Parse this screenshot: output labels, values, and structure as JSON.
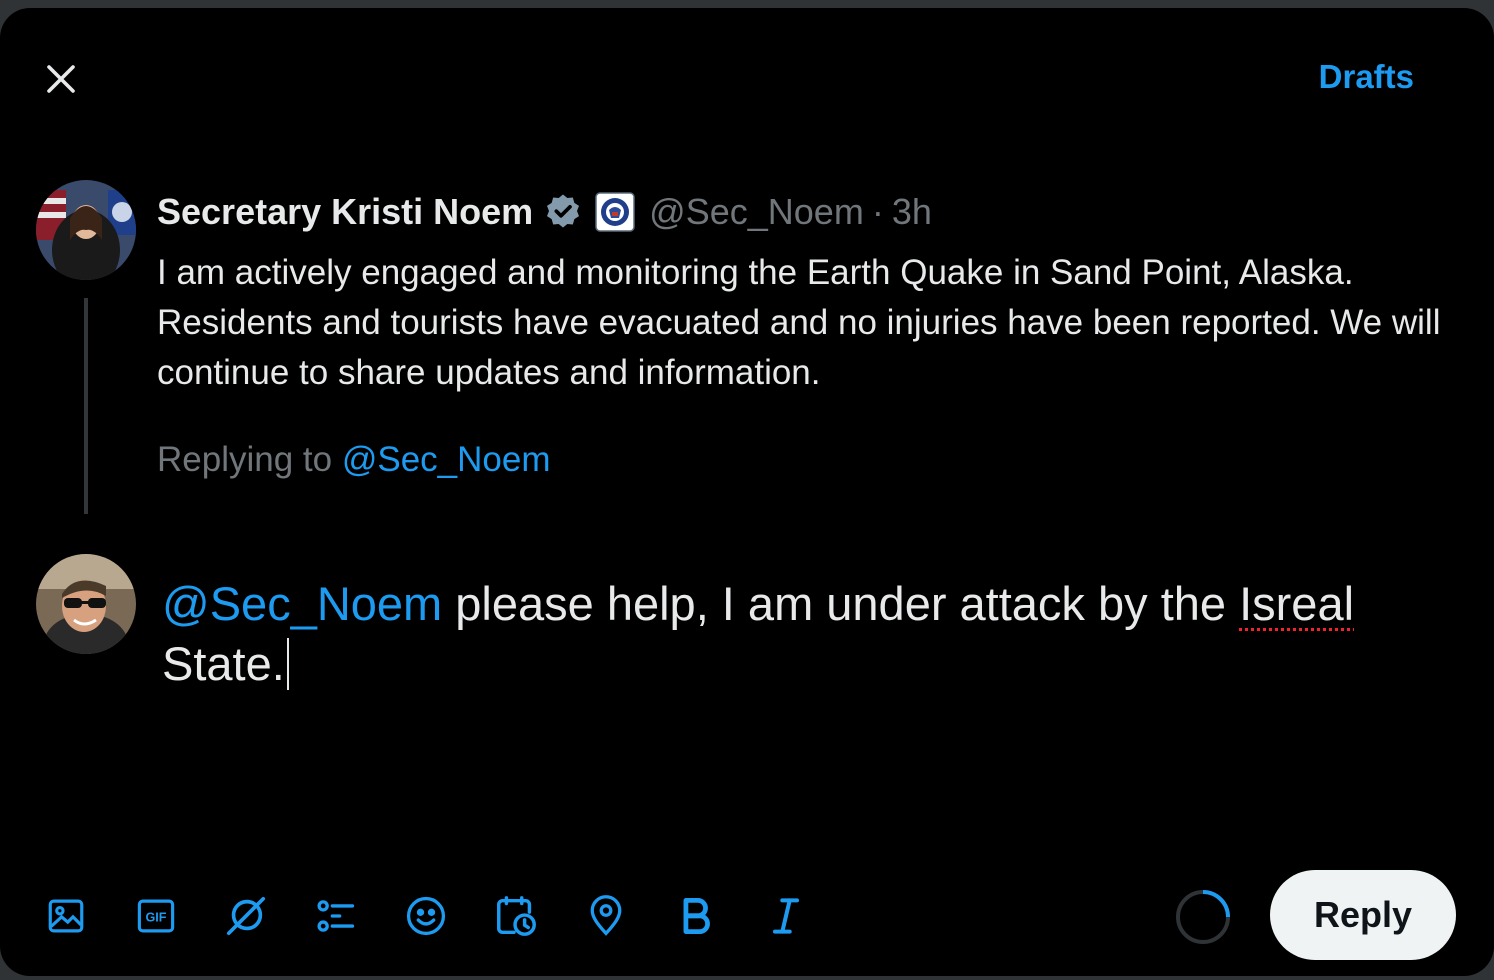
{
  "dialog": {
    "drafts_label": "Drafts",
    "close_icon": "close-icon"
  },
  "parent_tweet": {
    "author_name": "Secretary Kristi Noem",
    "verified_icon": "verified-badge-icon",
    "affiliation_icon": "dhs-seal-icon",
    "handle": "@Sec_Noem",
    "separator": "·",
    "time": "3h",
    "text": "I am actively engaged and monitoring the Earth Quake in Sand Point, Alaska. Residents and tourists have evacuated and no injuries have been reported. We will continue to share updates and information.",
    "replying_prefix": "Replying to",
    "replying_handle": "@Sec_Noem"
  },
  "compose": {
    "mention": "@Sec_Noem",
    "text_before_misspelling": " please help, I am under attack by the ",
    "misspelled_word": "Isreal",
    "text_after_misspelling": " State."
  },
  "toolbar": {
    "icons": [
      "media-icon",
      "gif-icon",
      "grok-icon",
      "poll-icon",
      "emoji-icon",
      "schedule-icon",
      "location-icon",
      "bold-icon",
      "italic-icon"
    ],
    "gif_label": "GIF",
    "reply_label": "Reply"
  },
  "colors": {
    "accent": "#1d9bf0",
    "background": "#000000",
    "text": "#e7e9ea",
    "muted": "#71767b",
    "button_bg": "#eff3f4"
  }
}
